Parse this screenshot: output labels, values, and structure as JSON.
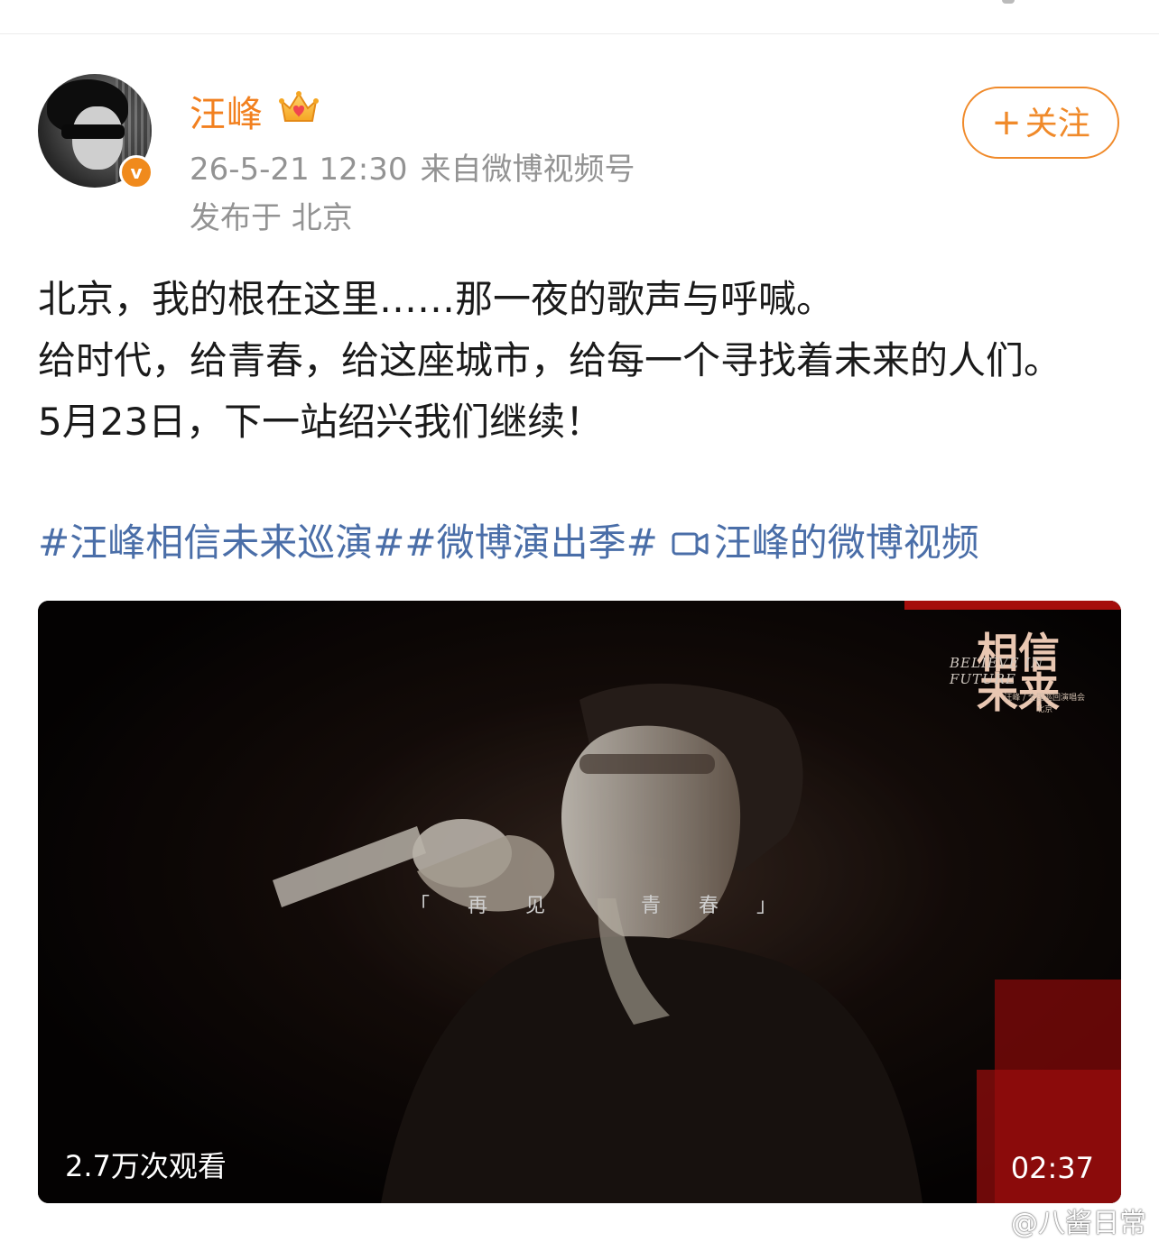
{
  "post": {
    "author_name": "汪峰",
    "timestamp": "26-5-21 12:30",
    "source": "来自微博视频号",
    "location": "发布于 北京",
    "follow_label": "关注",
    "follow_plus": "+",
    "verified_mark": "v",
    "paragraphs": [
      "北京，我的根在这里……那一夜的歌声与呼喊。",
      "给时代，给青春，给这座城市，给每一个寻找着未来的人们。",
      "5月23日，下一站绍兴我们继续！"
    ],
    "topics": [
      "#汪峰相信未来巡演#",
      "#微博演出季#"
    ],
    "video_link_label": "汪峰的微博视频"
  },
  "video": {
    "views": "2.7万次观看",
    "duration": "02:37",
    "subtitle": "「再见　青春」",
    "logo_main": "相信\n未来",
    "logo_en": "BELIEVE IN FUTURE",
    "logo_sub": "汪峰 / 全国巡回演唱会\n北京"
  },
  "watermark": "@八酱日常",
  "colors": {
    "accent": "#f2801f",
    "link": "#4a6ea8",
    "meta": "#939393"
  }
}
